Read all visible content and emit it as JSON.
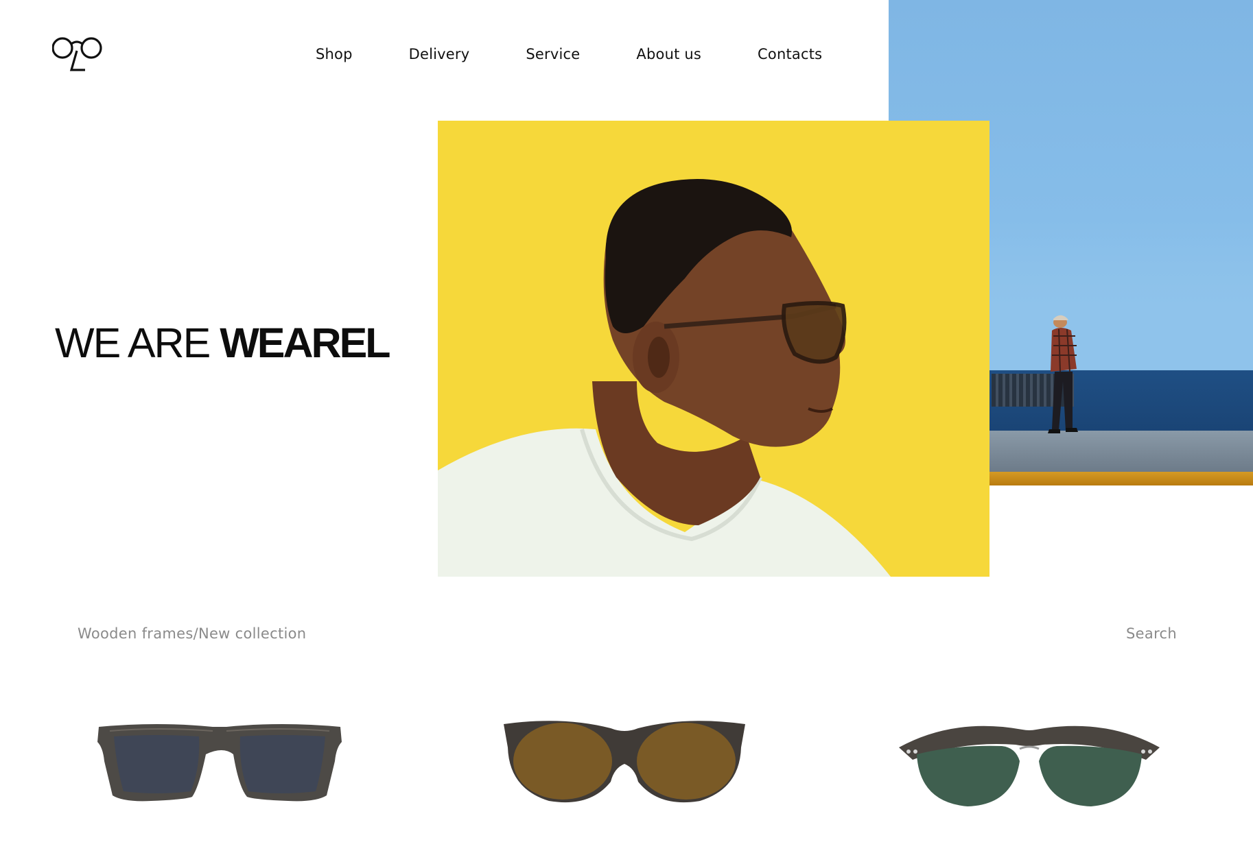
{
  "header": {
    "logo_icon": "glasses-logo-icon",
    "nav": [
      {
        "label": "Shop"
      },
      {
        "label": "Delivery"
      },
      {
        "label": "Service"
      },
      {
        "label": "About us"
      },
      {
        "label": "Contacts"
      }
    ]
  },
  "hero": {
    "headline_light": "WE ARE ",
    "headline_bold": "WEAREL",
    "colors": {
      "yellow_bg": "#f6d83a",
      "blue_bg": "#86bde9"
    }
  },
  "collection": {
    "breadcrumb": "Wooden frames/New collection",
    "search_label": "Search"
  },
  "products": [
    {
      "icon": "wayfarer-sunglasses-icon",
      "lens_color": "#3f4656"
    },
    {
      "icon": "round-sunglasses-icon",
      "lens_color": "#7a5a26"
    },
    {
      "icon": "clubmaster-sunglasses-icon",
      "lens_color": "#3f5f4f"
    }
  ]
}
